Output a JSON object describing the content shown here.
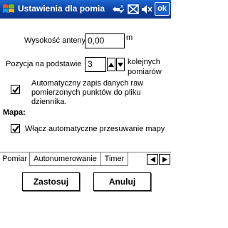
{
  "titlebar": {
    "title": "Ustawienia dla pomia",
    "ok_label": "ok"
  },
  "form": {
    "antenna_label": "Wysokość anteny:",
    "antenna_value": "0,00",
    "antenna_unit": "m",
    "position_label": "Pozycja na podstawie",
    "position_value": "3",
    "position_suffix_line1": "kolejnych",
    "position_suffix_line2": "pomiarów",
    "auto_save_line1": "Automatyczny zapis danych raw",
    "auto_save_line2": "pomierzonych punktów do pliku",
    "auto_save_line3": "dziennika.",
    "auto_save_checked": true,
    "map_section": "Mapa:",
    "auto_pan_label": "Włącz automatyczne przesuwanie mapy",
    "auto_pan_checked": true
  },
  "tabs": [
    {
      "label": "Pomiar",
      "active": true
    },
    {
      "label": "Autonumerowanie",
      "active": false
    },
    {
      "label": "Timer",
      "active": false
    }
  ],
  "buttons": {
    "apply": "Zastosuj",
    "cancel": "Anuluj"
  },
  "colors": {
    "titlebar": "#0b3f9e",
    "background": "#ffffff"
  }
}
